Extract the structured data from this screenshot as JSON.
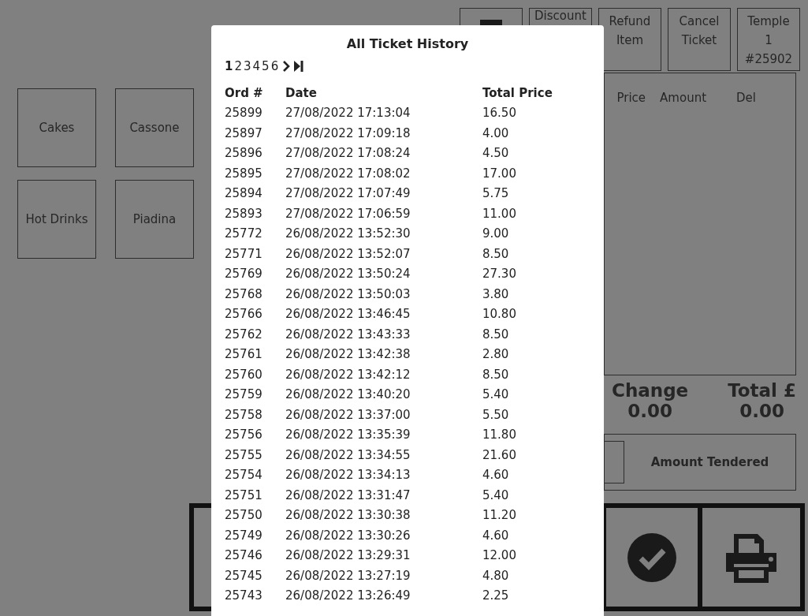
{
  "top_buttons": [
    {
      "kind": "menu"
    },
    {
      "kind": "text",
      "label": "Discount"
    },
    {
      "kind": "text",
      "label": "Refund Item"
    },
    {
      "kind": "text",
      "label": "Cancel Ticket"
    },
    {
      "kind": "text",
      "label": "Temple 1 #25902"
    }
  ],
  "categories": [
    "Cakes",
    "Cassone",
    "Hot Drinks",
    "Piadina"
  ],
  "order_table": {
    "columns": [
      "Price",
      "Amount",
      "Del"
    ]
  },
  "totals": [
    {
      "label": "Change",
      "value": "0.00"
    },
    {
      "label": "Total £",
      "value": "0.00"
    }
  ],
  "tender": {
    "label": "Amount Tendered"
  },
  "actions": [
    {
      "kind": "check"
    },
    {
      "kind": "print"
    }
  ],
  "modal": {
    "title": "All Ticket History",
    "pages": [
      {
        "label": "1",
        "selected": true
      },
      {
        "label": "2",
        "selected": false
      },
      {
        "label": "3",
        "selected": false
      },
      {
        "label": "4",
        "selected": false
      },
      {
        "label": "5",
        "selected": false
      },
      {
        "label": "6",
        "selected": false
      }
    ],
    "columns": [
      "Ord #",
      "Date",
      "Total Price"
    ],
    "rows": [
      [
        "25899",
        "27/08/2022 17:13:04",
        "16.50"
      ],
      [
        "25897",
        "27/08/2022 17:09:18",
        "4.00"
      ],
      [
        "25896",
        "27/08/2022 17:08:24",
        "4.50"
      ],
      [
        "25895",
        "27/08/2022 17:08:02",
        "17.00"
      ],
      [
        "25894",
        "27/08/2022 17:07:49",
        "5.75"
      ],
      [
        "25893",
        "27/08/2022 17:06:59",
        "11.00"
      ],
      [
        "25772",
        "26/08/2022 13:52:30",
        "9.00"
      ],
      [
        "25771",
        "26/08/2022 13:52:07",
        "8.50"
      ],
      [
        "25769",
        "26/08/2022 13:50:24",
        "27.30"
      ],
      [
        "25768",
        "26/08/2022 13:50:03",
        "3.80"
      ],
      [
        "25766",
        "26/08/2022 13:46:45",
        "10.80"
      ],
      [
        "25762",
        "26/08/2022 13:43:33",
        "8.50"
      ],
      [
        "25761",
        "26/08/2022 13:42:38",
        "2.80"
      ],
      [
        "25760",
        "26/08/2022 13:42:12",
        "8.50"
      ],
      [
        "25759",
        "26/08/2022 13:40:20",
        "5.40"
      ],
      [
        "25758",
        "26/08/2022 13:37:00",
        "5.50"
      ],
      [
        "25756",
        "26/08/2022 13:35:39",
        "11.80"
      ],
      [
        "25755",
        "26/08/2022 13:34:55",
        "21.60"
      ],
      [
        "25754",
        "26/08/2022 13:34:13",
        "4.60"
      ],
      [
        "25751",
        "26/08/2022 13:31:47",
        "5.40"
      ],
      [
        "25750",
        "26/08/2022 13:30:38",
        "11.20"
      ],
      [
        "25749",
        "26/08/2022 13:30:26",
        "4.60"
      ],
      [
        "25746",
        "26/08/2022 13:29:31",
        "12.00"
      ],
      [
        "25745",
        "26/08/2022 13:27:19",
        "4.80"
      ],
      [
        "25743",
        "26/08/2022 13:26:49",
        "2.25"
      ]
    ]
  }
}
